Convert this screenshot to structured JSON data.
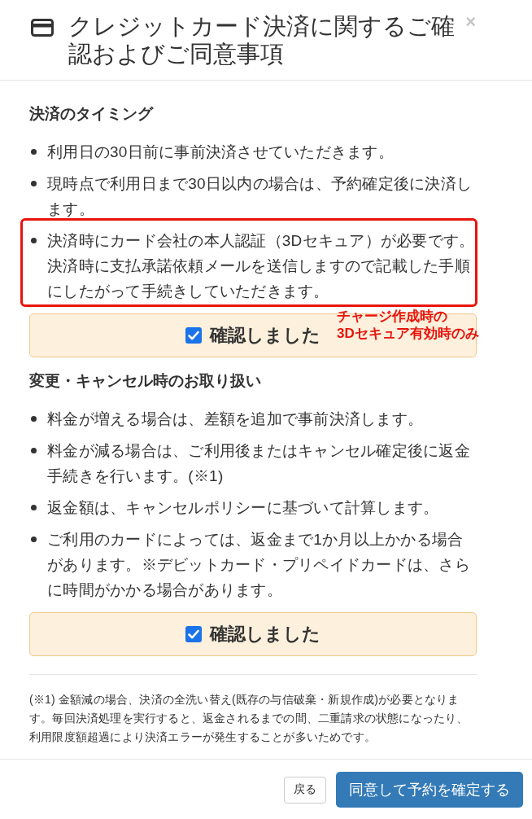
{
  "dialog": {
    "title": "クレジットカード決済に関するご確認およびご同意事項",
    "close": "×"
  },
  "sections": [
    {
      "heading": "決済のタイミング",
      "items": [
        {
          "text": "利用日の30日前に事前決済させていただきます。",
          "highlighted": false
        },
        {
          "text": "現時点で利用日まで30日以内の場合は、予約確定後に決済します。",
          "highlighted": false
        },
        {
          "text": "決済時にカード会社の本人認証（3Dセキュア）が必要です。決済時に支払承諾依頼メールを送信しますので記載した手順にしたがって手続きしていただきます。",
          "highlighted": true,
          "annotation": "チャージ作成時の\n3Dセキュア有効時のみ"
        }
      ],
      "confirm": {
        "label": "確認しました",
        "checked": true
      }
    },
    {
      "heading": "変更・キャンセル時のお取り扱い",
      "items": [
        {
          "text": "料金が増える場合は、差額を追加で事前決済します。",
          "highlighted": false
        },
        {
          "text": "料金が減る場合は、ご利用後またはキャンセル確定後に返金手続きを行います。(※1)",
          "highlighted": false
        },
        {
          "text": "返金額は、キャンセルポリシーに基づいて計算します。",
          "highlighted": false
        },
        {
          "text": "ご利用のカードによっては、返金まで1か月以上かかる場合があります。※デビットカード・プリペイドカードは、さらに時間がかかる場合があります。",
          "highlighted": false
        }
      ],
      "confirm": {
        "label": "確認しました",
        "checked": true
      }
    }
  ],
  "footnote": "(※1) 金額減の場合、決済の全洗い替え(既存の与信破棄・新規作成)が必要となります。毎回決済処理を実行すると、返金されるまでの間、二重請求の状態になったり、利用限度額超過により決済エラーが発生することが多いためです。",
  "buttons": [
    {
      "label": "戻る",
      "kind": "default"
    },
    {
      "label": "同意して予約を確定する",
      "kind": "primary"
    }
  ]
}
